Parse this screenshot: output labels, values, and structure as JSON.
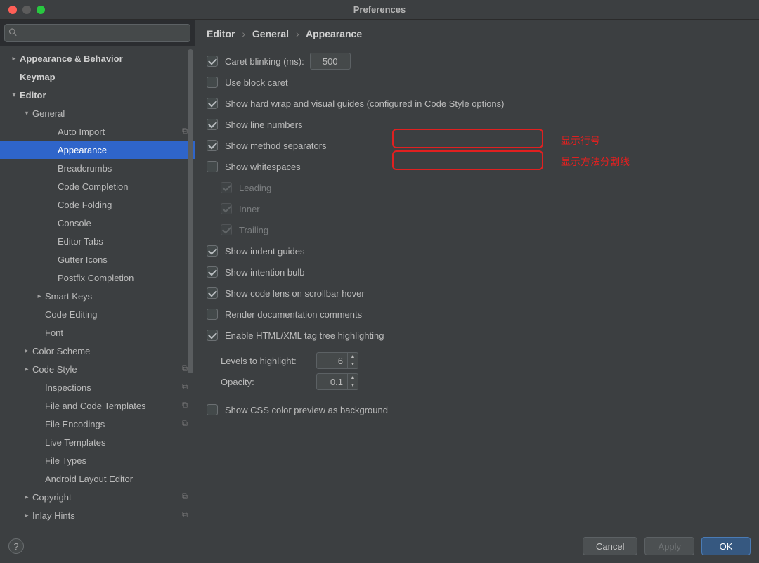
{
  "window": {
    "title": "Preferences"
  },
  "search": {
    "placeholder": ""
  },
  "sidebar": {
    "items": [
      {
        "label": "Appearance & Behavior",
        "bold": true,
        "chev": "right",
        "ind": 0
      },
      {
        "label": "Keymap",
        "bold": true,
        "chev": "",
        "ind": 0
      },
      {
        "label": "Editor",
        "bold": true,
        "chev": "down",
        "ind": 0
      },
      {
        "label": "General",
        "bold": false,
        "chev": "down",
        "ind": 1
      },
      {
        "label": "Auto Import",
        "bold": false,
        "chev": "",
        "ind": 3,
        "badge": true
      },
      {
        "label": "Appearance",
        "bold": false,
        "chev": "",
        "ind": 3,
        "selected": true
      },
      {
        "label": "Breadcrumbs",
        "bold": false,
        "chev": "",
        "ind": 3
      },
      {
        "label": "Code Completion",
        "bold": false,
        "chev": "",
        "ind": 3
      },
      {
        "label": "Code Folding",
        "bold": false,
        "chev": "",
        "ind": 3
      },
      {
        "label": "Console",
        "bold": false,
        "chev": "",
        "ind": 3
      },
      {
        "label": "Editor Tabs",
        "bold": false,
        "chev": "",
        "ind": 3
      },
      {
        "label": "Gutter Icons",
        "bold": false,
        "chev": "",
        "ind": 3
      },
      {
        "label": "Postfix Completion",
        "bold": false,
        "chev": "",
        "ind": 3
      },
      {
        "label": "Smart Keys",
        "bold": false,
        "chev": "right",
        "ind": 2
      },
      {
        "label": "Code Editing",
        "bold": false,
        "chev": "",
        "ind": 2
      },
      {
        "label": "Font",
        "bold": false,
        "chev": "",
        "ind": 2
      },
      {
        "label": "Color Scheme",
        "bold": false,
        "chev": "right",
        "ind": 1
      },
      {
        "label": "Code Style",
        "bold": false,
        "chev": "right",
        "ind": 1,
        "badge": true
      },
      {
        "label": "Inspections",
        "bold": false,
        "chev": "",
        "ind": 2,
        "badge": true
      },
      {
        "label": "File and Code Templates",
        "bold": false,
        "chev": "",
        "ind": 2,
        "badge": true
      },
      {
        "label": "File Encodings",
        "bold": false,
        "chev": "",
        "ind": 2,
        "badge": true
      },
      {
        "label": "Live Templates",
        "bold": false,
        "chev": "",
        "ind": 2
      },
      {
        "label": "File Types",
        "bold": false,
        "chev": "",
        "ind": 2
      },
      {
        "label": "Android Layout Editor",
        "bold": false,
        "chev": "",
        "ind": 2
      },
      {
        "label": "Copyright",
        "bold": false,
        "chev": "right",
        "ind": 1,
        "badge": true
      },
      {
        "label": "Inlay Hints",
        "bold": false,
        "chev": "right",
        "ind": 1,
        "badge": true
      }
    ]
  },
  "breadcrumb": {
    "p0": "Editor",
    "p1": "General",
    "p2": "Appearance"
  },
  "settings": {
    "caret_blinking_label": "Caret blinking (ms):",
    "caret_blinking_value": "500",
    "use_block_caret": "Use block caret",
    "show_hard_wrap": "Show hard wrap and visual guides (configured in Code Style options)",
    "show_line_numbers": "Show line numbers",
    "show_method_separators": "Show method separators",
    "show_whitespaces": "Show whitespaces",
    "ws_leading": "Leading",
    "ws_inner": "Inner",
    "ws_trailing": "Trailing",
    "show_indent_guides": "Show indent guides",
    "show_intention_bulb": "Show intention bulb",
    "show_code_lens": "Show code lens on scrollbar hover",
    "render_doc": "Render documentation comments",
    "enable_tag_tree": "Enable HTML/XML tag tree highlighting",
    "levels_label": "Levels to highlight:",
    "levels_value": "6",
    "opacity_label": "Opacity:",
    "opacity_value": "0.1",
    "css_color_preview": "Show CSS color preview as background"
  },
  "annotations": {
    "a1": "显示行号",
    "a2": "显示方法分割线"
  },
  "footer": {
    "cancel": "Cancel",
    "apply": "Apply",
    "ok": "OK"
  }
}
